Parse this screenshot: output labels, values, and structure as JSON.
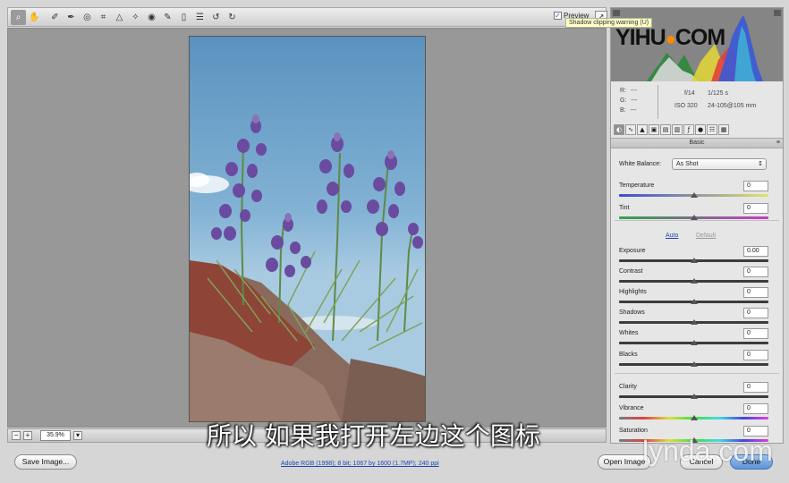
{
  "toolbar": {
    "tools": [
      "zoom-icon",
      "hand-icon",
      "white-balance-icon",
      "color-sampler-icon",
      "target-adjust-icon",
      "crop-icon",
      "straighten-icon",
      "spot-removal-icon",
      "red-eye-icon",
      "adjustment-brush-icon",
      "graduated-filter-icon",
      "preferences-icon",
      "rotate-ccw-icon",
      "rotate-cw-icon"
    ],
    "preview_label": "Preview",
    "tooltip": "Shadow clipping warning (U)"
  },
  "statusbar": {
    "zoom_minus": "−",
    "zoom_plus": "+",
    "zoom_value": "35.9%"
  },
  "footer": {
    "save_label": "Save Image...",
    "workflow_text": "Adobe RGB (1998); 8 bit; 1067 by 1600 (1.7MP); 240 ppi",
    "open_label": "Open Image",
    "cancel_label": "Cancel",
    "done_label": "Done"
  },
  "info": {
    "r_label": "R:",
    "g_label": "G:",
    "b_label": "B:",
    "rgb_value": "---",
    "aperture": "f/14",
    "shutter": "1/125 s",
    "iso": "ISO 320",
    "lens": "24-105@105 mm"
  },
  "panel": {
    "title": "Basic",
    "wb_label": "White Balance:",
    "wb_value": "As Shot",
    "auto_label": "Auto",
    "default_label": "Default",
    "sliders": [
      {
        "label": "Temperature",
        "value": "0",
        "pos": 0.5
      },
      {
        "label": "Tint",
        "value": "0",
        "pos": 0.5
      },
      {
        "label": "Exposure",
        "value": "0.00",
        "pos": 0.5
      },
      {
        "label": "Contrast",
        "value": "0",
        "pos": 0.5
      },
      {
        "label": "Highlights",
        "value": "0",
        "pos": 0.5
      },
      {
        "label": "Shadows",
        "value": "0",
        "pos": 0.5
      },
      {
        "label": "Whites",
        "value": "0",
        "pos": 0.5
      },
      {
        "label": "Blacks",
        "value": "0",
        "pos": 0.5
      },
      {
        "label": "Clarity",
        "value": "0",
        "pos": 0.5
      },
      {
        "label": "Vibrance",
        "value": "0",
        "pos": 0.5
      },
      {
        "label": "Saturation",
        "value": "0",
        "pos": 0.5
      }
    ]
  },
  "overlays": {
    "subtitle": "所以 如果我打开左边这个图标",
    "watermark_a": "YIHU",
    "watermark_b": "COM",
    "lynda": "lynda.com"
  }
}
